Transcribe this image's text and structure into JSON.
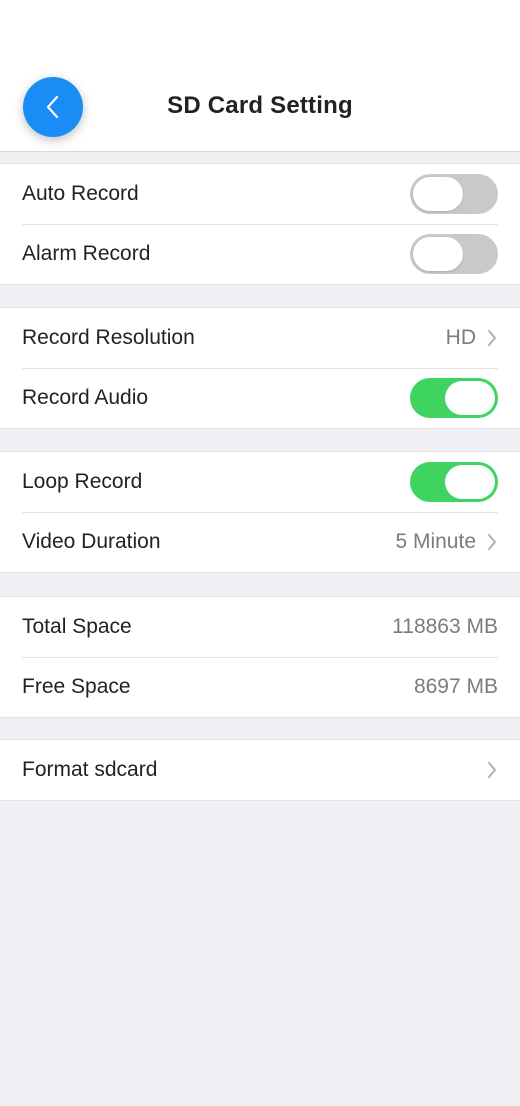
{
  "header": {
    "title": "SD Card Setting",
    "back_icon": "chevron-left-icon"
  },
  "colors": {
    "accent": "#1a8cf6",
    "toggle_on": "#3fd35f",
    "toggle_off": "#c9c9cc"
  },
  "groups": [
    {
      "rows": [
        {
          "label": "Auto Record",
          "toggle": "off"
        },
        {
          "label": "Alarm Record",
          "toggle": "off"
        }
      ]
    },
    {
      "rows": [
        {
          "label": "Record Resolution",
          "value": "HD"
        },
        {
          "label": "Record Audio",
          "toggle": "on"
        }
      ]
    },
    {
      "rows": [
        {
          "label": "Loop Record",
          "toggle": "on"
        },
        {
          "label": "Video Duration",
          "value": "5 Minute"
        }
      ]
    },
    {
      "rows": [
        {
          "label": "Total Space",
          "value": "118863 MB"
        },
        {
          "label": "Free Space",
          "value": "8697 MB"
        }
      ]
    },
    {
      "rows": [
        {
          "label": "Format sdcard"
        }
      ]
    }
  ]
}
